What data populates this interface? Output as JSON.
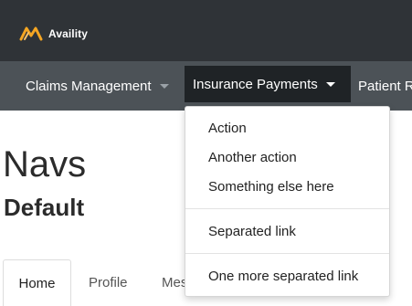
{
  "brand": {
    "name": "Availity",
    "logo_color": "#f5a623"
  },
  "navbar": {
    "items": [
      {
        "label": "Claims Management",
        "has_caret": true,
        "active": false
      },
      {
        "label": "Insurance Payments",
        "has_caret": true,
        "active": true
      },
      {
        "label": "Patient R",
        "has_caret": false,
        "active": false
      }
    ]
  },
  "dropdown": {
    "items": [
      "Action",
      "Another action",
      "Something else here"
    ],
    "separated_items": [
      "Separated link"
    ],
    "final_items": [
      "One more separated link"
    ]
  },
  "page": {
    "title": "Navs",
    "subtitle": "Default"
  },
  "tabs": [
    {
      "label": "Home",
      "active": true
    },
    {
      "label": "Profile",
      "active": false
    },
    {
      "label": "Mes",
      "active": false
    }
  ],
  "colors": {
    "topbar": "#2f3337",
    "navbar": "#4c5257",
    "active_nav": "#1f2326"
  }
}
